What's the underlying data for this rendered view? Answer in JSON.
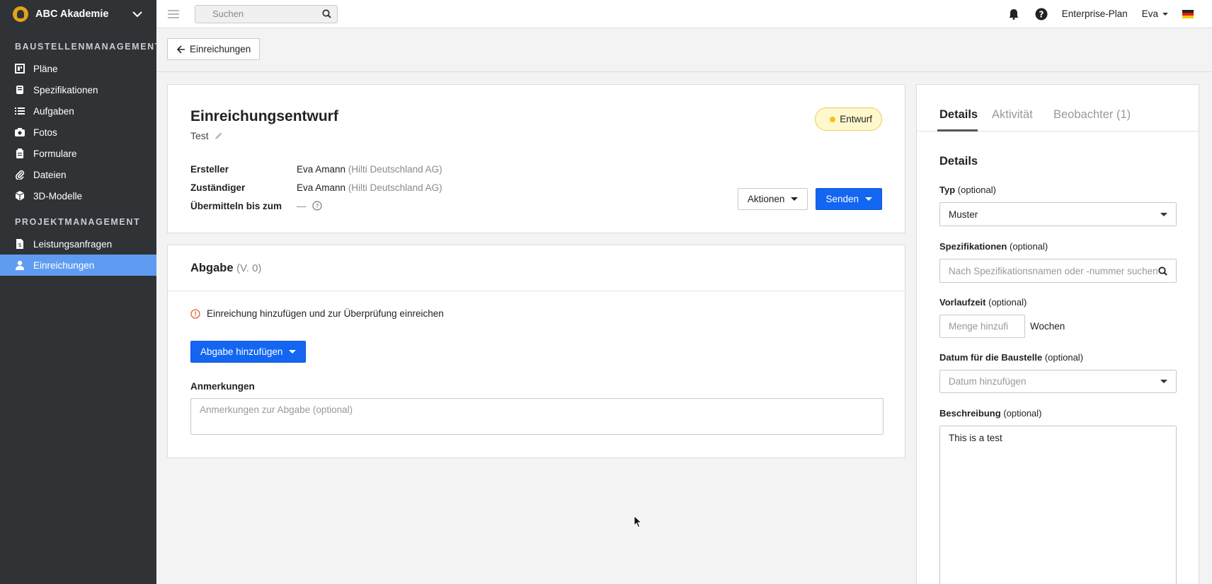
{
  "sidebar": {
    "org_name": "ABC Akademie",
    "section1": "BAUSTELLENMANAGEMENT",
    "items1": [
      {
        "label": "Pläne",
        "icon": "plans-icon"
      },
      {
        "label": "Spezifikationen",
        "icon": "spec-book-icon"
      },
      {
        "label": "Aufgaben",
        "icon": "list-icon"
      },
      {
        "label": "Fotos",
        "icon": "camera-icon"
      },
      {
        "label": "Formulare",
        "icon": "clipboard-icon"
      },
      {
        "label": "Dateien",
        "icon": "paperclip-icon"
      },
      {
        "label": "3D-Modelle",
        "icon": "cube-icon"
      }
    ],
    "section2": "PROJEKTMANAGEMENT",
    "items2": [
      {
        "label": "Leistungsanfragen",
        "icon": "document-dollar-icon"
      },
      {
        "label": "Einreichungen",
        "icon": "user-icon",
        "active": true
      }
    ]
  },
  "topbar": {
    "search_placeholder": "Suchen",
    "plan_label": "Enterprise-Plan",
    "user_name": "Eva"
  },
  "subheader": {
    "back_label": "Einreichungen"
  },
  "draft": {
    "title": "Einreichungsentwurf",
    "subtitle": "Test",
    "status": "Entwurf",
    "meta": [
      {
        "key": "Ersteller",
        "value": "Eva Amann",
        "company": "(Hilti Deutschland AG)"
      },
      {
        "key": "Zuständiger",
        "value": "Eva Amann",
        "company": "(Hilti Deutschland AG)"
      },
      {
        "key": "Übermitteln bis zum",
        "value": "—",
        "company": ""
      }
    ],
    "actions_label": "Aktionen",
    "send_label": "Senden"
  },
  "submission": {
    "title": "Abgabe",
    "version": "(V. 0)",
    "warning": "Einreichung hinzufügen und zur Überprüfung einreichen",
    "add_label": "Abgabe hinzufügen",
    "notes_label": "Anmerkungen",
    "notes_placeholder": "Anmerkungen zur Abgabe (optional)"
  },
  "panel": {
    "tabs": {
      "details": "Details",
      "activity": "Aktivität",
      "watchers": "Beobachter",
      "watchers_count": "(1)"
    },
    "title": "Details",
    "optional": "(optional)",
    "type_label": "Typ",
    "type_value": "Muster",
    "spec_label": "Spezifikationen",
    "spec_placeholder": "Nach Spezifikationsnamen oder -nummer suchen",
    "lead_label": "Vorlaufzeit",
    "lead_placeholder": "Menge hinzufi",
    "lead_unit": "Wochen",
    "date_label": "Datum für die Baustelle",
    "date_placeholder": "Datum hinzufügen",
    "desc_label": "Beschreibung",
    "desc_value": "This is a test"
  }
}
